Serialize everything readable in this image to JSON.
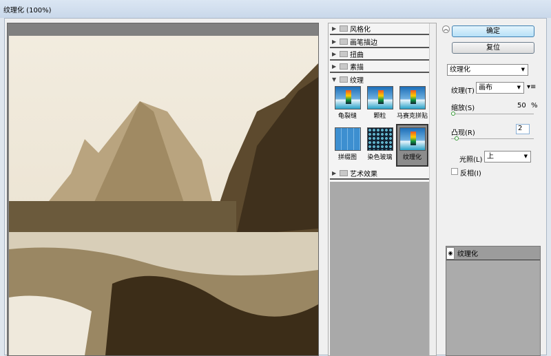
{
  "window": {
    "title": "纹理化 (100%)"
  },
  "categories": [
    {
      "label": "风格化",
      "expanded": false
    },
    {
      "label": "画笔描边",
      "expanded": false
    },
    {
      "label": "扭曲",
      "expanded": false
    },
    {
      "label": "素描",
      "expanded": false
    },
    {
      "label": "纹理",
      "expanded": true
    },
    {
      "label": "艺术效果",
      "expanded": false
    }
  ],
  "texture_filters": [
    "龟裂缝",
    "颗粒",
    "马赛克拼贴",
    "拼缀图",
    "染色玻璃",
    "纹理化"
  ],
  "selected_filter": "纹理化",
  "buttons": {
    "ok": "确定",
    "reset": "复位"
  },
  "filter_select": "纹理化",
  "params": {
    "texture_label": "纹理(T)",
    "texture_value": "画布",
    "scale_label": "缩放(S)",
    "scale_value": "50",
    "scale_unit": "%",
    "scale_fraction": 0.0,
    "relief_label": "凸现(R)",
    "relief_value": "2",
    "relief_fraction": 0.04,
    "light_label": "光照(L)",
    "light_value": "上",
    "invert_label": "反相(I)",
    "invert_checked": false
  },
  "layers": [
    {
      "label": "纹理化",
      "visible": true
    }
  ]
}
